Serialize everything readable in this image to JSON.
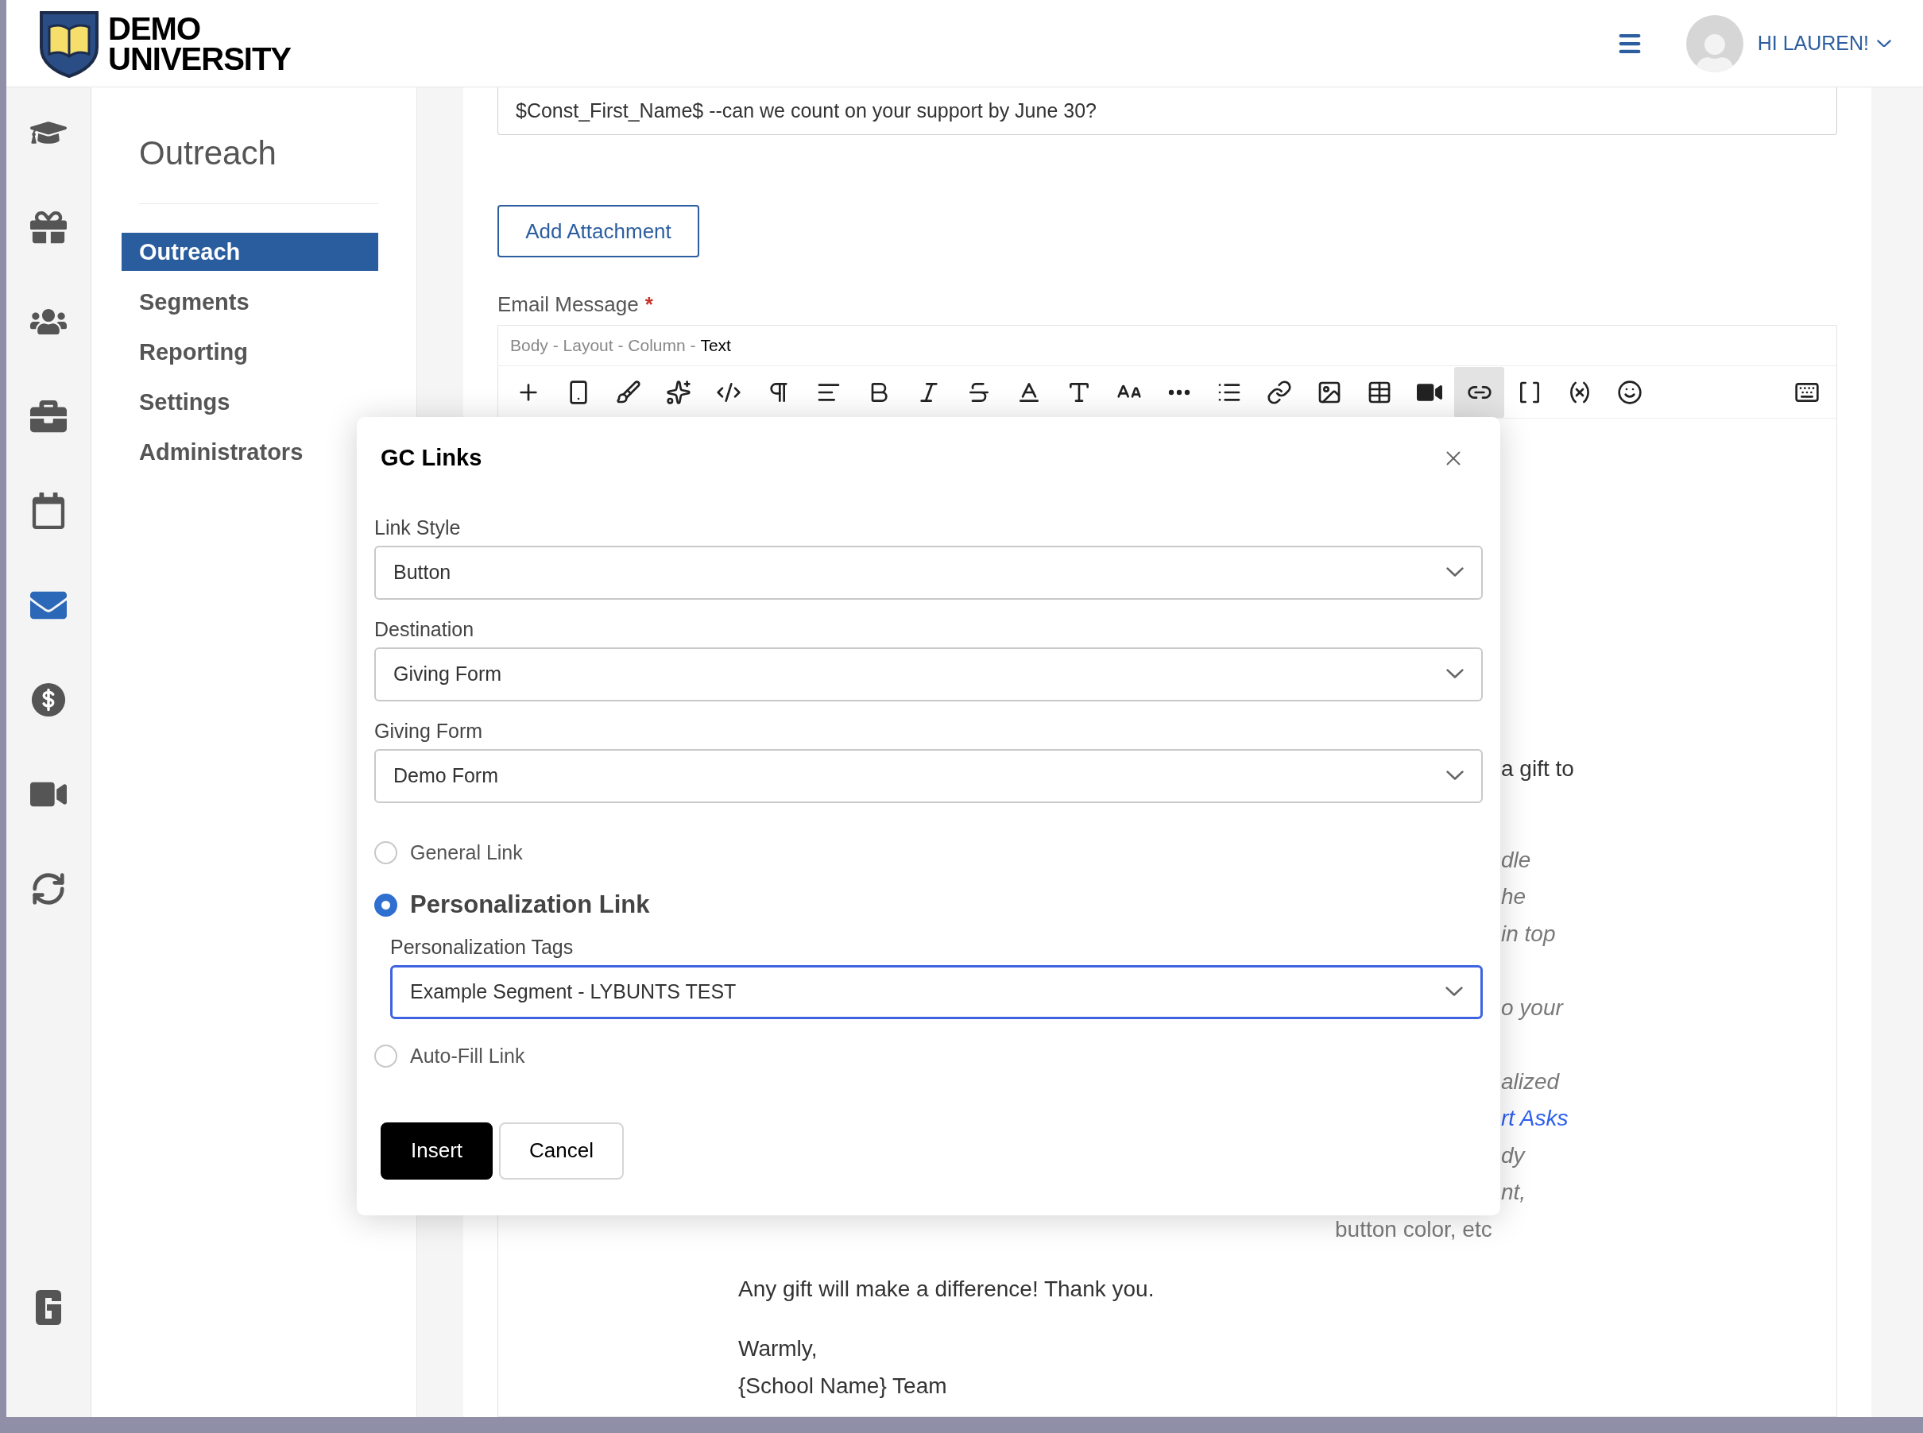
{
  "brand": {
    "line1": "DEMO",
    "line2": "UNIVERSITY"
  },
  "header": {
    "greeting": "HI LAUREN!"
  },
  "rail": [
    {
      "selected": false
    },
    {
      "selected": false
    },
    {
      "selected": false
    },
    {
      "selected": false
    },
    {
      "selected": false
    },
    {
      "selected": true
    },
    {
      "selected": false
    },
    {
      "selected": false
    },
    {
      "selected": false
    }
  ],
  "sidebar": {
    "title": "Outreach",
    "items": [
      {
        "label": "Outreach",
        "selected": true
      },
      {
        "label": "Segments",
        "selected": false
      },
      {
        "label": "Reporting",
        "selected": false
      },
      {
        "label": "Settings",
        "selected": false
      },
      {
        "label": "Administrators",
        "selected": false
      }
    ]
  },
  "subject": {
    "value": "$Const_First_Name$ --can we count on your support by June 30?"
  },
  "add_attachment": "Add Attachment",
  "email_message": {
    "label": "Email Message",
    "required_mark": "*",
    "breadcrumb": [
      "Body",
      "Layout",
      "Column"
    ],
    "breadcrumb_current": "Text",
    "separator": "-"
  },
  "toolbar_buttons": [
    {
      "selected": false
    },
    {
      "selected": false
    },
    {
      "selected": false
    },
    {
      "selected": false
    },
    {
      "selected": false
    },
    {
      "selected": false
    },
    {
      "selected": false
    },
    {
      "selected": false
    },
    {
      "selected": false
    },
    {
      "selected": false
    },
    {
      "selected": false
    },
    {
      "selected": false
    },
    {
      "selected": false
    },
    {
      "selected": false
    },
    {
      "selected": false
    },
    {
      "selected": false
    },
    {
      "selected": false
    },
    {
      "selected": false
    },
    {
      "selected": false
    },
    {
      "selected": true
    },
    {
      "selected": false
    },
    {
      "selected": false
    },
    {
      "selected": false
    },
    {
      "selected": false
    }
  ],
  "body_fragments": [
    {
      "text": "a gift to",
      "kind": "plain"
    },
    {
      "text": "dle",
      "kind": "hint"
    },
    {
      "text": "he",
      "kind": "hint"
    },
    {
      "text": "in top",
      "kind": "hint"
    },
    {
      "kind": "blank"
    },
    {
      "text": "o your",
      "kind": "hint"
    },
    {
      "kind": "blank"
    },
    {
      "text": "alized",
      "kind": "hint"
    },
    {
      "text": "rt Asks",
      "kind": "link"
    },
    {
      "text": "dy",
      "kind": "hint"
    },
    {
      "text": "nt,",
      "kind": "hint"
    }
  ],
  "body_hint_tail": "button color, etc",
  "body_text": [
    "Any gift will make a difference! Thank you.",
    "Warmly,",
    "{School Name} Team"
  ],
  "dialog": {
    "title": "GC Links",
    "selects": [
      {
        "label": "Link Style",
        "value": "Button"
      },
      {
        "label": "Destination",
        "value": "Giving Form"
      },
      {
        "label": "Giving Form",
        "value": "Demo Form"
      }
    ],
    "link_types": [
      {
        "label": "General Link",
        "selected": false
      },
      {
        "label": "Personalization Link",
        "selected": true
      },
      {
        "label": "Auto-Fill Link",
        "selected": false
      }
    ],
    "personalization": {
      "label": "Personalization Tags",
      "value": "Example Segment - LYBUNTS TEST",
      "focused": true
    },
    "buttons": [
      {
        "label": "Insert",
        "kind": "primary"
      },
      {
        "label": "Cancel",
        "kind": "secondary"
      }
    ]
  }
}
